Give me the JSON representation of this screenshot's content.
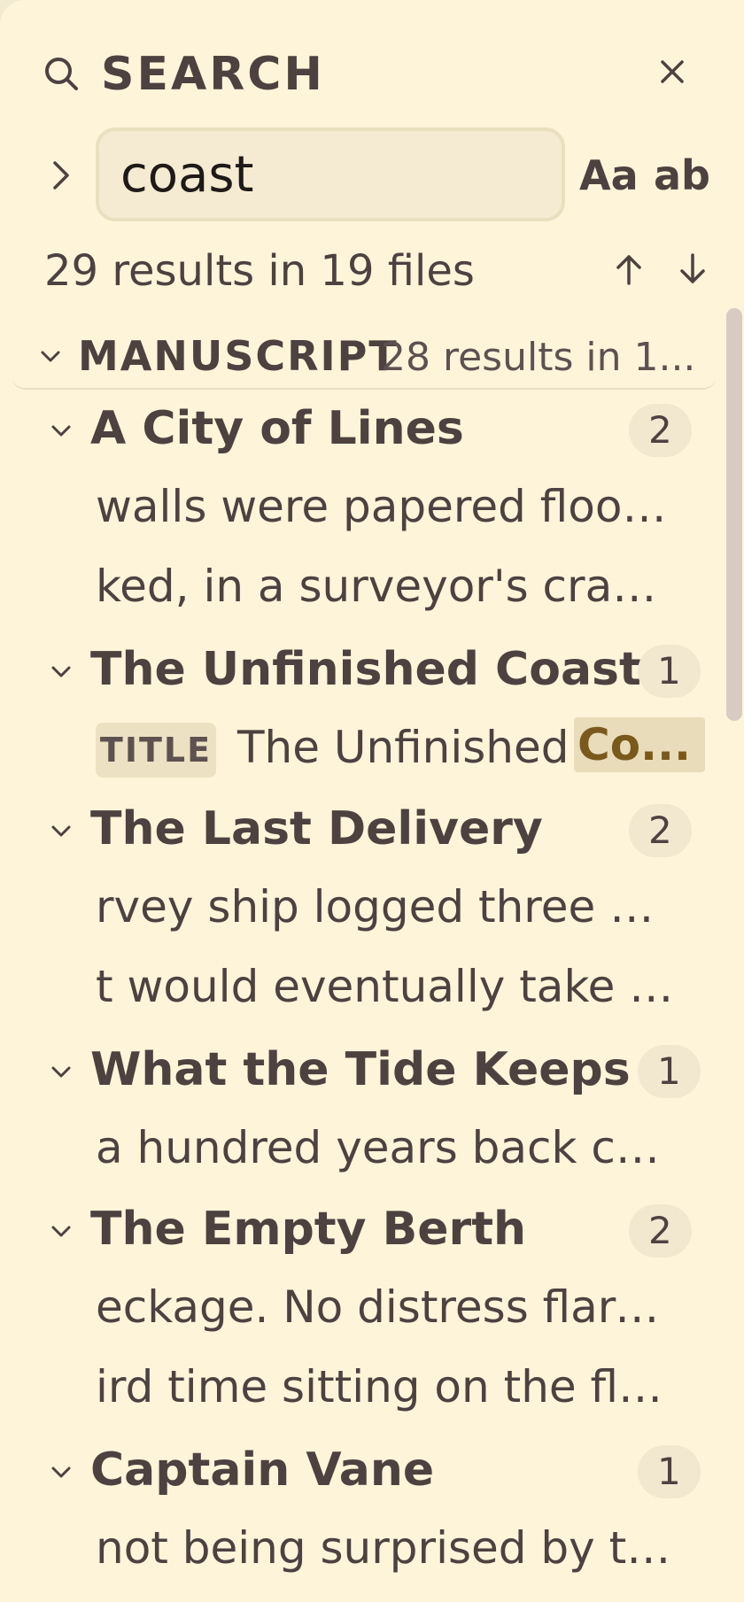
{
  "header": {
    "title": "SEARCH"
  },
  "search": {
    "value": "coast",
    "placeholder": ""
  },
  "options": {
    "match_case": "Aa",
    "whole_word": "ab"
  },
  "summary": {
    "text": "29 results in 19 files"
  },
  "group": {
    "name": "MANUSCRIPT",
    "count": "28 results in 1..."
  },
  "files": [
    {
      "name": "A City of Lines",
      "count": "2",
      "matches": [
        "walls were papered floor ...",
        "ked, in a surveyor's cram..."
      ]
    },
    {
      "name": "The Unfinished Coast",
      "count": "1",
      "title_match": {
        "tag": "TITLE",
        "text": "The Unfinished",
        "highlight": "Co..."
      }
    },
    {
      "name": "The Last Delivery",
      "count": "2",
      "matches": [
        "rvey ship logged three hu...",
        "t would eventually take hi..."
      ]
    },
    {
      "name": "What the Tide Keeps",
      "count": "1",
      "matches": [
        "a hundred years back call..."
      ]
    },
    {
      "name": "The Empty Berth",
      "count": "2",
      "matches": [
        "eckage. No distress flare ...",
        "ird time sitting on the floo..."
      ]
    },
    {
      "name": "Captain Vane",
      "count": "1",
      "matches": [
        "not being surprised by thi..."
      ]
    }
  ],
  "colors": {
    "panel_bg": "#fdf4d9",
    "text": "#4d4240",
    "highlight_bg": "#e8dcbb",
    "highlight_text": "#7a5a1c"
  },
  "icons": [
    "search-icon",
    "close-icon",
    "chevron-right-icon",
    "arrow-up-icon",
    "arrow-down-icon",
    "chevron-down-icon"
  ]
}
